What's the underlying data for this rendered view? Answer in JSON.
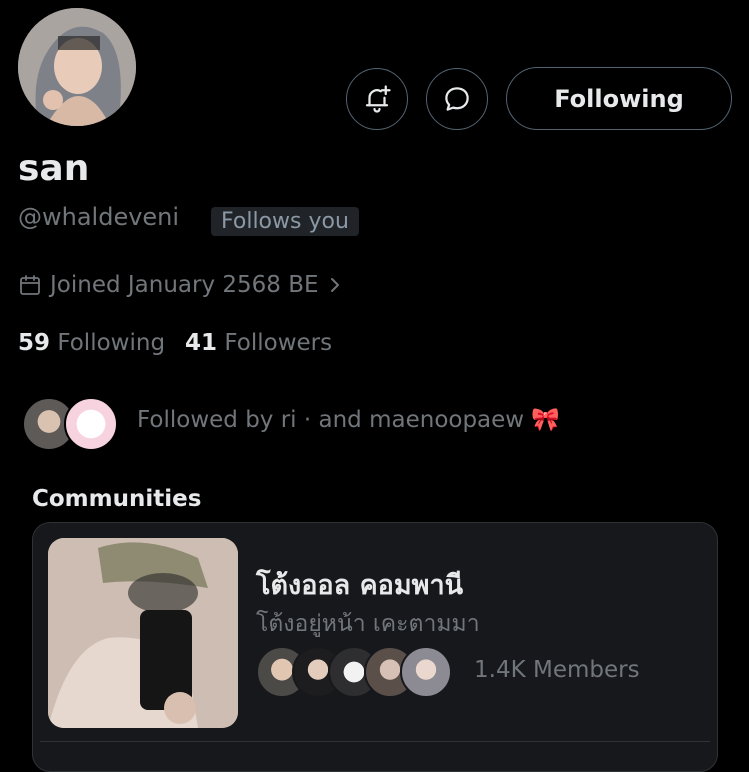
{
  "profile": {
    "name": "san",
    "handle": "@whaldeveni",
    "follows_you": "Follows you",
    "joined": "Joined January 2568 BE",
    "following_count": "59",
    "following_label": "Following",
    "followers_count": "41",
    "followers_label": "Followers",
    "followed_by": "Followed by ri · and maenoopaew 🎀"
  },
  "actions": {
    "follow_label": "Following",
    "notify_icon": "bell-plus-icon",
    "message_icon": "message-icon"
  },
  "communities": {
    "heading": "Communities",
    "items": [
      {
        "name": "โต้งออล คอมพานี",
        "subtitle": "โต้งอยู่หน้า เคะตามมา",
        "members": "1.4K Members"
      }
    ]
  },
  "colors": {
    "background": "#000000",
    "text_primary": "#e7e9ea",
    "text_secondary": "#71767b",
    "border": "#536471"
  }
}
